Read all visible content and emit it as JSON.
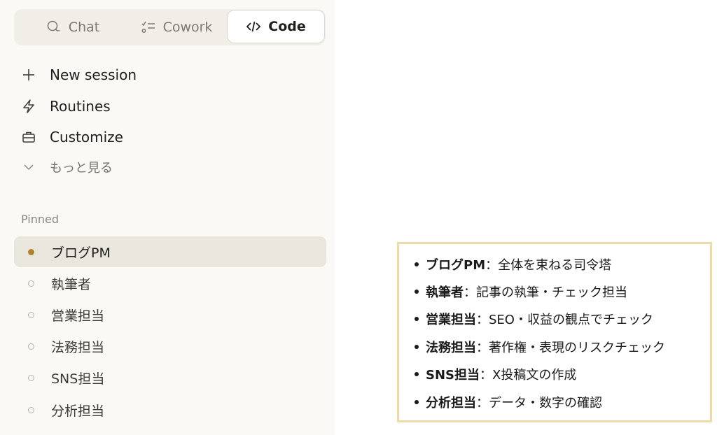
{
  "mode_tabs": [
    {
      "label": "Chat",
      "icon": "chat-bubble-icon"
    },
    {
      "label": "Cowork",
      "icon": "checklist-icon"
    },
    {
      "label": "Code",
      "icon": "code-icon",
      "active": true
    }
  ],
  "nav": {
    "new_session": "New session",
    "routines": "Routines",
    "customize": "Customize",
    "more": "もっと見る"
  },
  "pinned": {
    "label": "Pinned",
    "items": [
      "ブログPM",
      "執筆者",
      "営業担当",
      "法務担当",
      "SNS担当",
      "分析担当"
    ],
    "active_index": 0
  },
  "notes": [
    {
      "name": "ブログPM",
      "desc": "：全体を束ねる司令塔"
    },
    {
      "name": "執筆者",
      "desc": "：記事の執筆・チェック担当"
    },
    {
      "name": "営業担当",
      "desc": "：SEO・収益の観点でチェック"
    },
    {
      "name": "法務担当",
      "desc": "：著作権・表現のリスクチェック"
    },
    {
      "name": "SNS担当",
      "desc": "：X投稿文の作成"
    },
    {
      "name": "分析担当",
      "desc": "：データ・数字の確認"
    }
  ],
  "colors": {
    "sidebar_bg": "#faf9f5",
    "active_dot": "#b0822a",
    "note_border": "#ebdba8"
  }
}
